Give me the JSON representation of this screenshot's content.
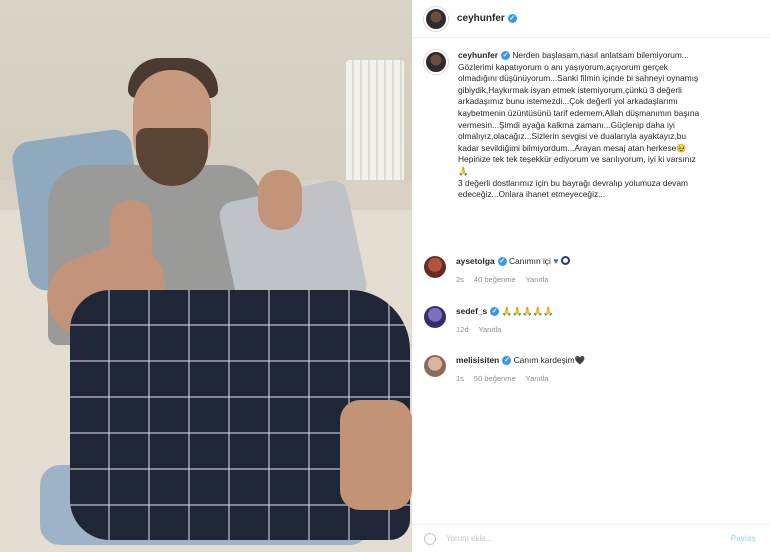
{
  "post": {
    "username": "ceyhunfer",
    "caption_lines": [
      "Nerden başlasam,nasıl anlatsam bilemiyorum...",
      "Gözlerimi kapatıyorum o anı yaşıyorum,açıyorum gerçek",
      "olmadığını düşünüyorum...Sanki filmin içinde bi sahneyi oynamış",
      "gibiydik,Haykırmak isyan etmek istemiyorum,çünkü 3 değerli",
      "arkadaşımız bunu istemezdi...Çok değerli yol arkadaşlarımı",
      "kaybetmenin üzüntüsünü tarif edemem,Allah düşmanımın başına",
      "vermesin...Şimdi ayağa kalkma zamanı...Güçlenip daha iyi",
      "olmalıyız,olacağız...Sizlerin sevgisi ve dualarıyla ayaktayız,bu",
      "kadar sevildiğimi bilmiyordum...Arayan mesaj atan herkese🥹",
      "Hepinize tek tek teşekkür ediyorum ve sarılıyorum, iyi ki varsınız",
      "🙏",
      "3 değerli dostlarımız için bu bayrağı devralıp yolumuza devam",
      "edeceğiz...Onlara ihanet etmeyeceğiz..."
    ]
  },
  "comments": [
    {
      "username": "aysetolga",
      "text": "Canımın içi",
      "time": "2s",
      "likes": "40 beğenme",
      "reply": "Yanıtla",
      "emoji": "blue-heart-and-nazar"
    },
    {
      "username": "sedef_s",
      "text": "🙏🙏🙏🙏🙏",
      "time": "12d",
      "likes": "",
      "reply": "Yanıtla"
    },
    {
      "username": "melisisiten",
      "text": "Canım kardeşim🖤",
      "time": "1s",
      "likes": "50 beğenme",
      "reply": "Yanıtla"
    }
  ],
  "footer": {
    "placeholder": "Yorum ekle...",
    "post_label": "Paylaş"
  },
  "colors": {
    "verified": "#3897f0",
    "link": "#8e8e8e",
    "accent_heart": "#3b6fd6"
  }
}
